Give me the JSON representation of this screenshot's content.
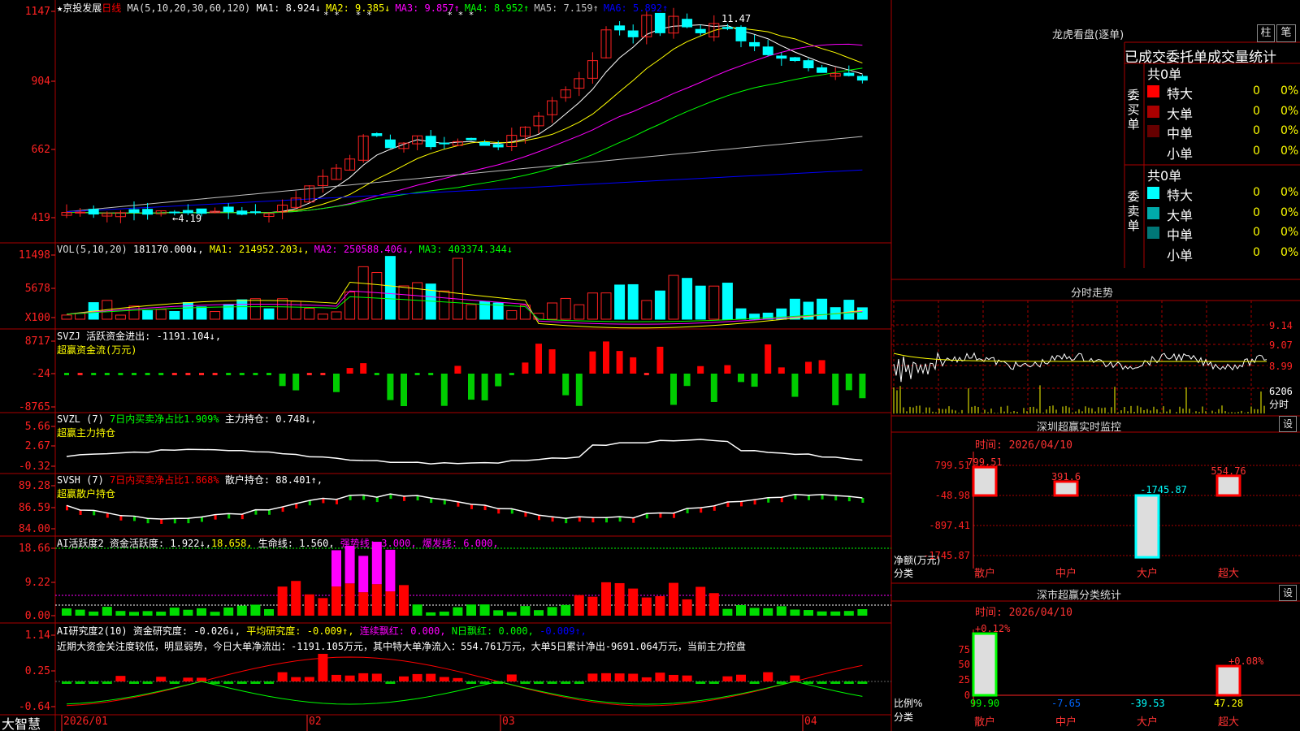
{
  "stock": {
    "star": "★",
    "name": "京投发展",
    "period": "日线"
  },
  "ma_line": {
    "params": "MA(5,10,20,30,60,120)",
    "items": [
      {
        "label": "MA1:",
        "value": "8.924↓",
        "color": "#ffffff"
      },
      {
        "label": "MA2:",
        "value": "9.385↓",
        "color": "#ffff00"
      },
      {
        "label": "MA3:",
        "value": "9.857↑",
        "color": "#ff00ff"
      },
      {
        "label": "MA4:",
        "value": "8.952↑",
        "color": "#00ff00"
      },
      {
        "label": "MA5:",
        "value": "7.159↑",
        "color": "#c0c0c0"
      },
      {
        "label": "MA6:",
        "value": "5.892↑",
        "color": "#0000ff"
      }
    ],
    "star_marks": "* *   * *              * * *"
  },
  "price_axis": [
    "1147",
    "904",
    "662",
    "419"
  ],
  "high_label": "11.47",
  "low_label": "←4.19",
  "vol": {
    "params": "VOL(5,10,20)",
    "value": "181170.000↓,",
    "items": [
      {
        "label": "MA1:",
        "value": "214952.203↓,",
        "color": "#ffff00"
      },
      {
        "label": "MA2:",
        "value": "250588.406↓,",
        "color": "#ff00ff"
      },
      {
        "label": "MA3:",
        "value": "403374.344↓",
        "color": "#00ff00"
      }
    ],
    "axis": [
      "11498",
      "5678",
      "X100"
    ]
  },
  "svzj": {
    "line": "SVZJ  活跃资金进出: -1191.104↓,",
    "title": "超赢资金流(万元)",
    "axis": [
      "8717",
      "-24",
      "-8765"
    ]
  },
  "svzl": {
    "prefix": "SVZL (7)",
    "ratio": "7日内买卖净占比1.909%",
    "hold": "主力持仓: 0.748↓,",
    "title": "超赢主力持仓",
    "axis": [
      "5.66",
      "2.67",
      "-0.32"
    ]
  },
  "svsh": {
    "prefix": "SVSH (7)",
    "ratio": "7日内买卖净占比1.868%",
    "hold": "散户持仓: 88.401↑,",
    "title": "超赢散户持仓",
    "axis": [
      "89.28",
      "86.59",
      "84.00"
    ]
  },
  "ai_active": {
    "name": "AI活跃度2",
    "value": "资金活跃度: 1.922↓,",
    "v2": "18.658,",
    "life": "生命线: 1.560,",
    "strong": "强势线: 3.000,",
    "burst": "爆发线: 6.000,",
    "axis": [
      "18.66",
      "9.22",
      "0.00"
    ]
  },
  "ai_research": {
    "name": "AI研究度2(10)",
    "value": "资金研究度: -0.026↓,",
    "avg": "平均研究度: -0.009↑,",
    "red": "连续飘红: 0.000,",
    "nred": "N日飘红: 0.000,",
    "tail": "-0.009↑,",
    "comment": "近期大资金关注度较低，明显弱势，今日大单净流出：-1191.105万元，其中特大单净流入：554.761万元，大单5日累计净出-9691.064万元，当前主力控盘",
    "axis": [
      "1.14",
      "0.25",
      "-0.64"
    ]
  },
  "date_axis": [
    "2026/01",
    "02",
    "03",
    "04"
  ],
  "brand": "大智慧",
  "lhb": {
    "title": "龙虎看盘(逐单)",
    "btn1": "柱",
    "btn2": "笔",
    "header": "已成交委托单成交量统计",
    "buy": {
      "side": "委买单",
      "total": "共0单",
      "rows": [
        {
          "label": "特大",
          "count": "0",
          "pct": "0%",
          "color": "#ff0000"
        },
        {
          "label": "大单",
          "count": "0",
          "pct": "0%",
          "color": "#aa0000"
        },
        {
          "label": "中单",
          "count": "0",
          "pct": "0%",
          "color": "#660000"
        },
        {
          "label": "小单",
          "count": "0",
          "pct": "0%",
          "color": ""
        }
      ]
    },
    "sell": {
      "side": "委卖单",
      "total": "共0单",
      "rows": [
        {
          "label": "特大",
          "count": "0",
          "pct": "0%",
          "color": "#00ffff"
        },
        {
          "label": "大单",
          "count": "0",
          "pct": "0%",
          "color": "#00aaaa"
        },
        {
          "label": "中单",
          "count": "0",
          "pct": "0%",
          "color": "#007777"
        },
        {
          "label": "小单",
          "count": "0",
          "pct": "0%",
          "color": ""
        }
      ]
    }
  },
  "intraday": {
    "title": "分时走势",
    "axis": [
      "9.14",
      "9.07",
      "8.99"
    ],
    "vol": "6206",
    "unit": "分时"
  },
  "sz_monitor": {
    "title": "深圳超赢实时监控",
    "btn": "设",
    "time": "时间: 2026/04/10",
    "axis": [
      "799.51",
      "-48.98",
      "-897.41",
      "-1745.87"
    ],
    "ylabel": "净额(万元)",
    "xlabel": "分类",
    "cats": [
      "散户",
      "中户",
      "大户",
      "超大"
    ],
    "values": [
      799.51,
      391.6,
      -1745.87,
      554.76
    ],
    "labels": [
      "799.51",
      "391.6",
      "-1745.87",
      "554.76"
    ]
  },
  "sz_class": {
    "title": "深市超赢分类统计",
    "btn": "设",
    "time": "时间: 2026/04/10",
    "axis": [
      "75",
      "50",
      "25",
      "0"
    ],
    "ylabel": "比例%",
    "xlabel": "分类",
    "cats": [
      "散户",
      "中户",
      "大户",
      "超大"
    ],
    "bottom": [
      "99.90",
      "-7.65",
      "-39.53",
      "47.28"
    ],
    "tops": [
      "+0.12%",
      "",
      "",
      "+0.08%"
    ],
    "values": [
      99.9,
      0,
      0,
      47.28
    ]
  },
  "colors": {
    "up": "#ff0000",
    "down": "#00ffff",
    "grid": "#aa0000",
    "axis": "#ff3333"
  }
}
